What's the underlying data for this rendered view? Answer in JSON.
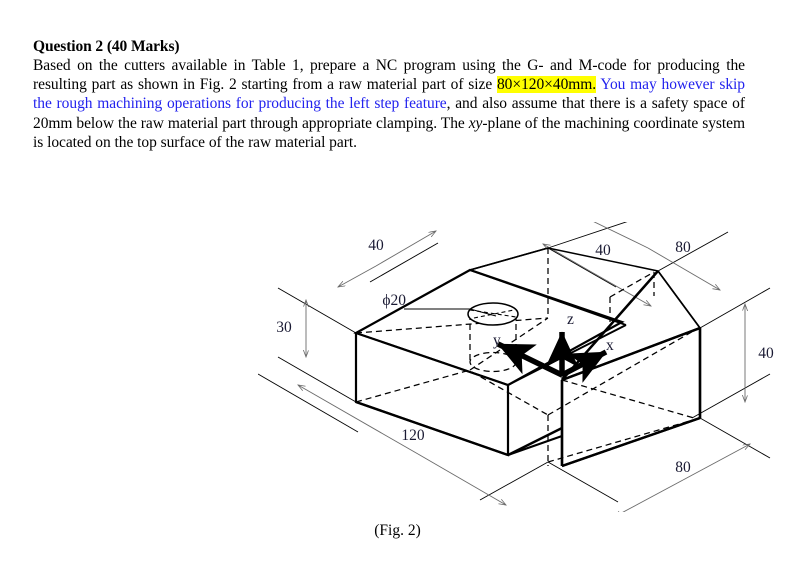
{
  "document": {
    "title": "Question 2 (40 Marks)",
    "paragraph": {
      "seg1": "Based on the cutters available in Table 1, prepare a NC program using the G- and M-code for producing the resulting part as shown in Fig. 2 starting from a raw material part of size ",
      "highlight": "80×120×40mm.",
      "seg2_blue": " You may however skip the rough machining operations for producing the left step feature",
      "seg3": ", and also assume that there is a safety space of 20mm below the raw material part through appropriate clamping. The ",
      "italic_xy": "xy",
      "seg4": "-plane of the machining coordinate system is located on the top surface of the raw material part."
    },
    "figure_caption": "(Fig. 2)"
  },
  "figure": {
    "name": "isometric-stepped-block",
    "dimensions": {
      "top_left_40": "40",
      "top_right_40": "40",
      "top_right_80": "80",
      "left_height_30": "30",
      "right_height_40": "40",
      "front_length_120": "120",
      "front_depth_80": "80",
      "hole_diameter": "ϕ20"
    },
    "axes": {
      "x_label": "x",
      "y_label": "y",
      "z_label": "z"
    }
  },
  "colors": {
    "highlight": "#FFFF00",
    "blue_text": "#2222EE",
    "dimension_text": "#1a1a33",
    "line": "#000000",
    "dim_line": "#6b6b6b",
    "background": "#ffffff"
  }
}
